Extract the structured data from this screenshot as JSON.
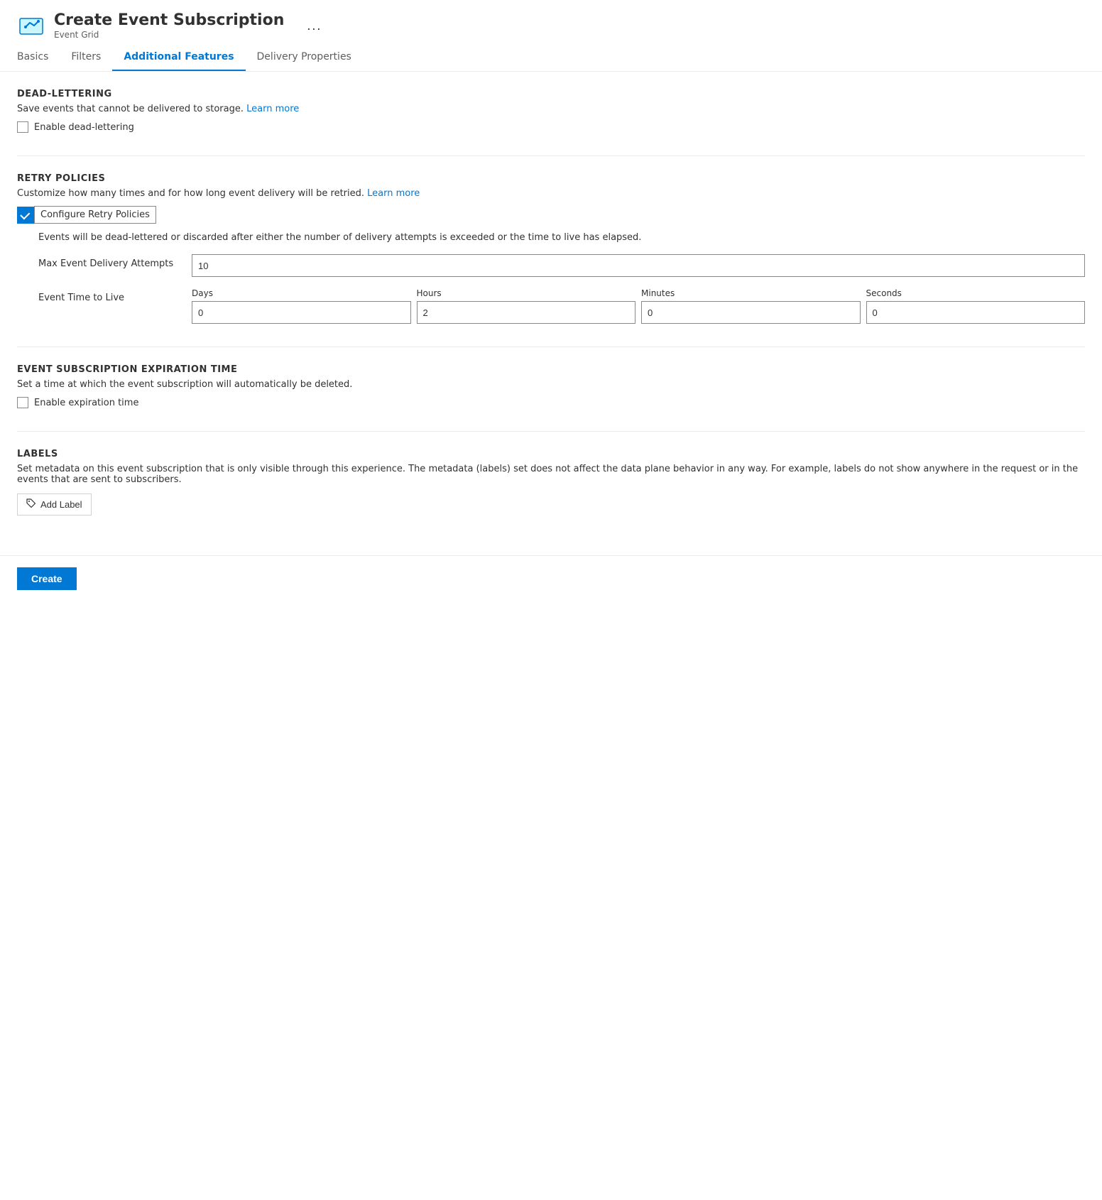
{
  "header": {
    "title": "Create Event Subscription",
    "subtitle": "Event Grid",
    "more_label": "..."
  },
  "tabs": [
    {
      "id": "basics",
      "label": "Basics",
      "active": false
    },
    {
      "id": "filters",
      "label": "Filters",
      "active": false
    },
    {
      "id": "additional-features",
      "label": "Additional Features",
      "active": true
    },
    {
      "id": "delivery-properties",
      "label": "Delivery Properties",
      "active": false
    }
  ],
  "sections": {
    "dead_lettering": {
      "title": "DEAD-LETTERING",
      "description": "Save events that cannot be delivered to storage.",
      "learn_more_label": "Learn more",
      "learn_more_url": "#",
      "checkbox_label": "Enable dead-lettering",
      "checked": false
    },
    "retry_policies": {
      "title": "RETRY POLICIES",
      "description": "Customize how many times and for how long event delivery will be retried.",
      "learn_more_label": "Learn more",
      "learn_more_url": "#",
      "configure_label": "Configure Retry Policies",
      "configure_checked": true,
      "events_note": "Events will be dead-lettered or discarded after either the number of delivery attempts is exceeded or the time to live has elapsed.",
      "max_delivery_attempts": {
        "label": "Max Event Delivery Attempts",
        "value": "10"
      },
      "event_time_to_live": {
        "label": "Event Time to Live",
        "days_label": "Days",
        "days_value": "0",
        "hours_label": "Hours",
        "hours_value": "2",
        "minutes_label": "Minutes",
        "minutes_value": "0",
        "seconds_label": "Seconds",
        "seconds_value": "0"
      }
    },
    "expiration": {
      "title": "EVENT SUBSCRIPTION EXPIRATION TIME",
      "description": "Set a time at which the event subscription will automatically be deleted.",
      "checkbox_label": "Enable expiration time",
      "checked": false
    },
    "labels": {
      "title": "LABELS",
      "description": "Set metadata on this event subscription that is only visible through this experience. The metadata (labels) set does not affect the data plane behavior in any way. For example, labels do not show anywhere in the request or in the events that are sent to subscribers.",
      "add_label_button": "Add Label"
    }
  },
  "footer": {
    "create_button": "Create"
  }
}
